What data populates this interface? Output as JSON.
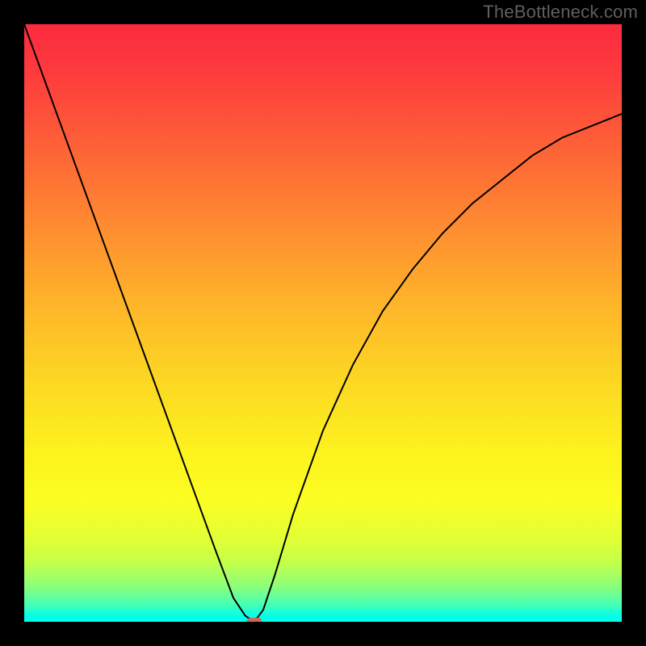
{
  "watermark": "TheBottleneck.com",
  "chart_data": {
    "type": "line",
    "title": "",
    "xlabel": "",
    "ylabel": "",
    "xlim": [
      0,
      100
    ],
    "ylim": [
      0,
      100
    ],
    "grid": false,
    "legend": false,
    "background_gradient": {
      "top_color": "#fc2a3f",
      "mid_color": "#fcd823",
      "bottom_color": "#02ffee",
      "meaning": "bottleneck severity scale (red = high bottleneck, green = balanced)"
    },
    "series": [
      {
        "name": "bottleneck-curve",
        "type": "line",
        "color": "#000000",
        "x": [
          0,
          4,
          8,
          12,
          16,
          20,
          24,
          28,
          32,
          35,
          37,
          38.5,
          40,
          42,
          45,
          50,
          55,
          60,
          65,
          70,
          75,
          80,
          85,
          90,
          95,
          100
        ],
        "y": [
          100,
          89,
          78,
          67,
          56,
          45,
          34,
          23,
          12,
          4,
          1,
          0,
          2,
          8,
          18,
          32,
          43,
          52,
          59,
          65,
          70,
          74,
          78,
          81,
          83,
          85
        ]
      }
    ],
    "annotations": [
      {
        "name": "optimal-point",
        "shape": "rounded-rect",
        "x": 38.5,
        "y": 0,
        "color": "#c96959"
      }
    ]
  }
}
